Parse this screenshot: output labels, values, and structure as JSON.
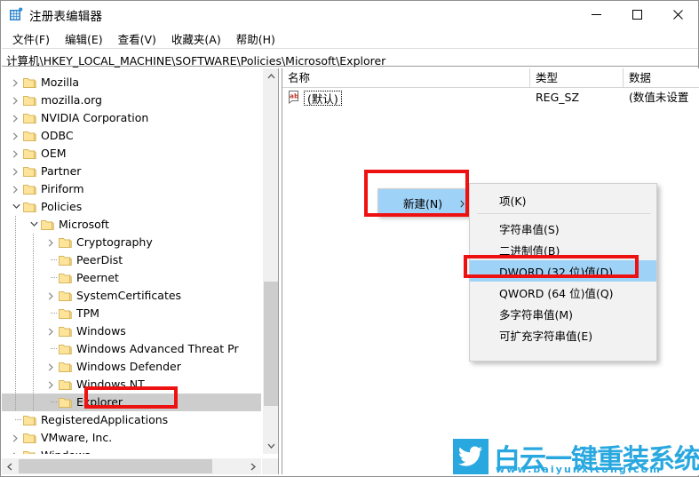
{
  "window": {
    "title": "注册表编辑器",
    "icon": "registry-editor-icon",
    "controls": {
      "minimize": "minimize-icon",
      "maximize": "maximize-icon",
      "close": "close-icon"
    }
  },
  "menubar": {
    "items": [
      {
        "label": "文件(F)"
      },
      {
        "label": "编辑(E)"
      },
      {
        "label": "查看(V)"
      },
      {
        "label": "收藏夹(A)"
      },
      {
        "label": "帮助(H)"
      }
    ]
  },
  "address": {
    "path": "计算机\\HKEY_LOCAL_MACHINE\\SOFTWARE\\Policies\\Microsoft\\Explorer"
  },
  "tree": {
    "items": [
      {
        "label": "Mozilla",
        "depth": 1,
        "state": "collapsed",
        "selected": false
      },
      {
        "label": "mozilla.org",
        "depth": 1,
        "state": "collapsed",
        "selected": false
      },
      {
        "label": "NVIDIA Corporation",
        "depth": 1,
        "state": "collapsed",
        "selected": false
      },
      {
        "label": "ODBC",
        "depth": 1,
        "state": "collapsed",
        "selected": false
      },
      {
        "label": "OEM",
        "depth": 1,
        "state": "collapsed",
        "selected": false
      },
      {
        "label": "Partner",
        "depth": 1,
        "state": "collapsed",
        "selected": false
      },
      {
        "label": "Piriform",
        "depth": 1,
        "state": "collapsed",
        "selected": false
      },
      {
        "label": "Policies",
        "depth": 1,
        "state": "expanded",
        "selected": false
      },
      {
        "label": "Microsoft",
        "depth": 2,
        "state": "expanded",
        "selected": false
      },
      {
        "label": "Cryptography",
        "depth": 3,
        "state": "collapsed",
        "selected": false
      },
      {
        "label": "PeerDist",
        "depth": 3,
        "state": "leaf",
        "selected": false
      },
      {
        "label": "Peernet",
        "depth": 3,
        "state": "leaf",
        "selected": false
      },
      {
        "label": "SystemCertificates",
        "depth": 3,
        "state": "collapsed",
        "selected": false
      },
      {
        "label": "TPM",
        "depth": 3,
        "state": "leaf",
        "selected": false
      },
      {
        "label": "Windows",
        "depth": 3,
        "state": "collapsed",
        "selected": false
      },
      {
        "label": "Windows Advanced Threat Pr",
        "depth": 3,
        "state": "leaf",
        "selected": false
      },
      {
        "label": "Windows Defender",
        "depth": 3,
        "state": "collapsed",
        "selected": false
      },
      {
        "label": "Windows NT",
        "depth": 3,
        "state": "collapsed",
        "selected": false
      },
      {
        "label": "Explorer",
        "depth": 3,
        "state": "leaf",
        "selected": true
      },
      {
        "label": "RegisteredApplications",
        "depth": 1,
        "state": "leaf",
        "selected": false
      },
      {
        "label": "VMware, Inc.",
        "depth": 1,
        "state": "collapsed",
        "selected": false
      },
      {
        "label": "Windows",
        "depth": 1,
        "state": "collapsed",
        "selected": false
      }
    ]
  },
  "list": {
    "columns": [
      {
        "label": "名称"
      },
      {
        "label": "类型"
      },
      {
        "label": "数据"
      }
    ],
    "rows": [
      {
        "name": "(默认)",
        "type": "REG_SZ",
        "data": "(数值未设置",
        "icon": "string-value-icon"
      }
    ]
  },
  "context_menu": {
    "label": "新建(N)",
    "arrow": "submenu-arrow-icon",
    "highlighted": true
  },
  "submenu": {
    "items": [
      {
        "label": "项(K)",
        "highlighted": false,
        "separator_after": true
      },
      {
        "label": "字符串值(S)",
        "highlighted": false,
        "separator_after": false
      },
      {
        "label": "二进制值(B)",
        "highlighted": false,
        "separator_after": false
      },
      {
        "label": "DWORD (32 位)值(D)",
        "highlighted": true,
        "separator_after": false
      },
      {
        "label": "QWORD (64 位)值(Q)",
        "highlighted": false,
        "separator_after": false
      },
      {
        "label": "多字符串值(M)",
        "highlighted": false,
        "separator_after": false
      },
      {
        "label": "可扩充字符串值(E)",
        "highlighted": false,
        "separator_after": false
      }
    ]
  },
  "watermark": {
    "title": "白云一键重装系统",
    "url": "www.baiyunxitong.com",
    "icon": "bird-icon",
    "color": "#29a8e0"
  },
  "colors": {
    "highlight": "#9fd2f7",
    "annotation": "#ee1111",
    "selection": "#cdcdcd",
    "folder": "#fde49a"
  }
}
